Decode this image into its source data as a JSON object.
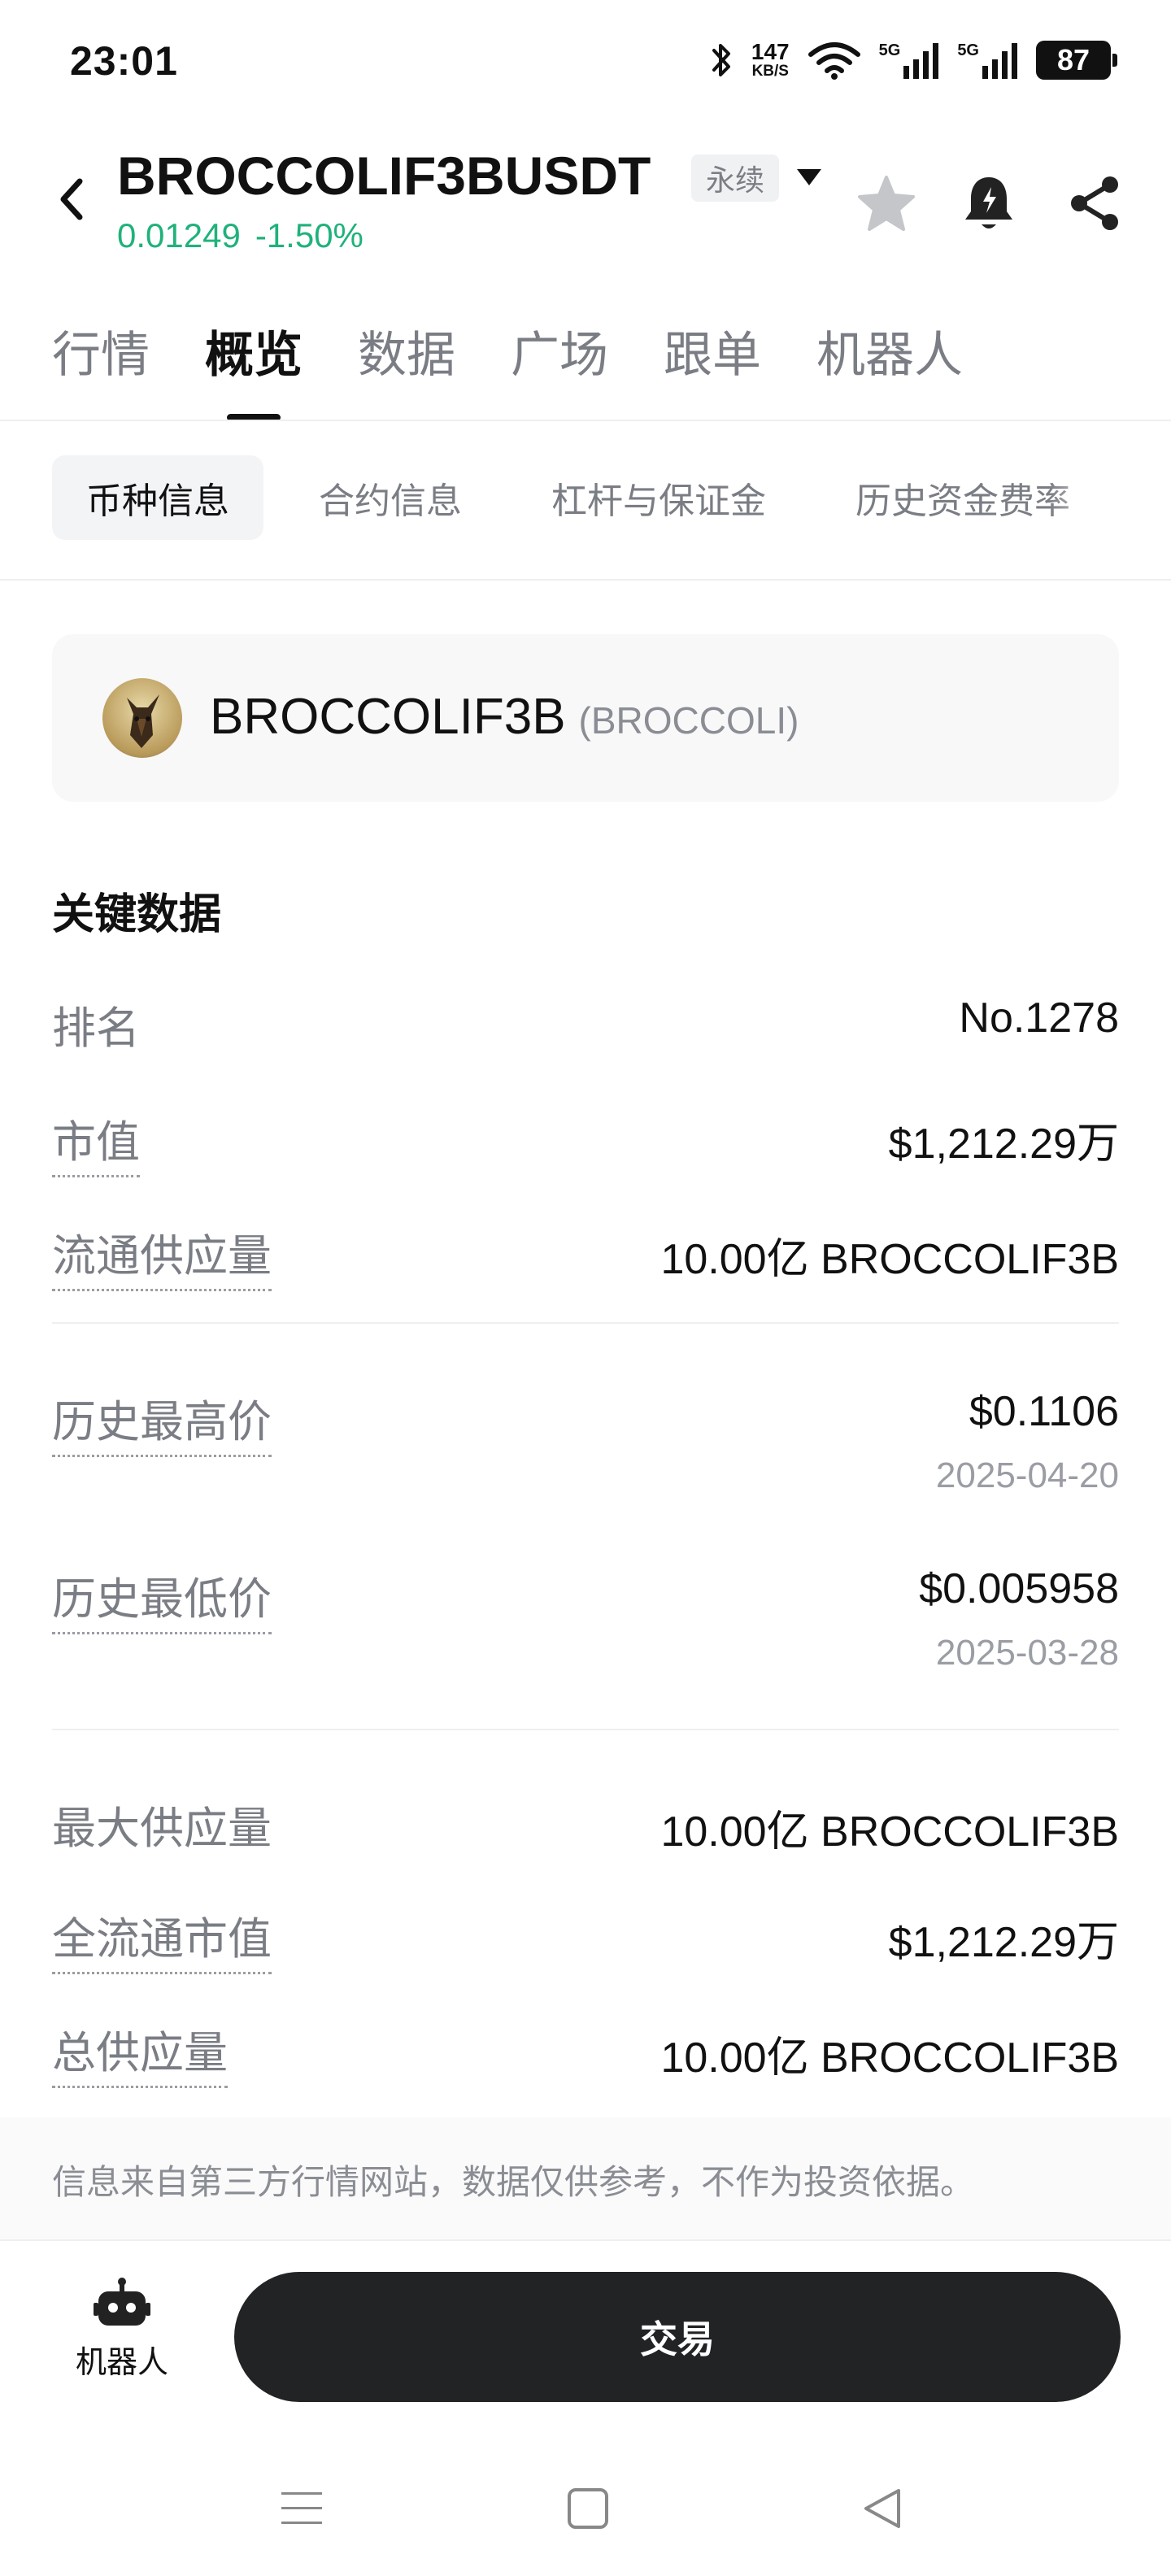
{
  "status_bar": {
    "time": "23:01",
    "net_speed_value": "147",
    "net_speed_unit": "KB/S",
    "signal1_label": "5G",
    "signal2_label": "5G",
    "battery": "87",
    "icons": [
      "bluetooth-icon",
      "wifi-icon",
      "signal-5g-icon",
      "signal-5g-icon",
      "battery-icon"
    ]
  },
  "header": {
    "title": "BROCCOLIF3BUSDT",
    "badge": "永续",
    "price": "0.01249",
    "change": "-1.50%",
    "price_color": "#1fb27b",
    "icons": [
      "back-icon",
      "caret-down-icon",
      "star-icon",
      "alert-bell-icon",
      "share-icon"
    ]
  },
  "main_tabs": [
    {
      "label": "行情",
      "active": false
    },
    {
      "label": "概览",
      "active": true
    },
    {
      "label": "数据",
      "active": false
    },
    {
      "label": "广场",
      "active": false
    },
    {
      "label": "跟单",
      "active": false
    },
    {
      "label": "机器人",
      "active": false
    }
  ],
  "sub_tabs": [
    {
      "label": "币种信息",
      "active": true
    },
    {
      "label": "合约信息",
      "active": false
    },
    {
      "label": "杠杆与保证金",
      "active": false
    },
    {
      "label": "历史资金费率",
      "active": false
    }
  ],
  "coin": {
    "name": "BROCCOLIF3B",
    "symbol": "(BROCCOLI)"
  },
  "key_data": {
    "title": "关键数据",
    "rank_label": "排名",
    "rank_value": "No.1278",
    "market_cap_label": "市值",
    "market_cap_value": "$1,212.29万",
    "circulating_label": "流通供应量",
    "circulating_value": "10.00亿 BROCCOLIF3B",
    "ath_label": "历史最高价",
    "ath_value": "$0.1106",
    "ath_date": "2025-04-20",
    "atl_label": "历史最低价",
    "atl_value": "$0.005958",
    "atl_date": "2025-03-28",
    "max_supply_label": "最大供应量",
    "max_supply_value": "10.00亿 BROCCOLIF3B",
    "fdv_label": "全流通市值",
    "fdv_value": "$1,212.29万",
    "total_supply_label": "总供应量",
    "total_supply_value": "10.00亿 BROCCOLIF3B"
  },
  "disclaimer": "信息来自第三方行情网站，数据仅供参考，不作为投资依据。",
  "bottom": {
    "robot_label": "机器人",
    "trade_label": "交易"
  },
  "nav_bar": {
    "icons": [
      "menu-icon",
      "home-square-icon",
      "back-triangle-icon"
    ]
  }
}
